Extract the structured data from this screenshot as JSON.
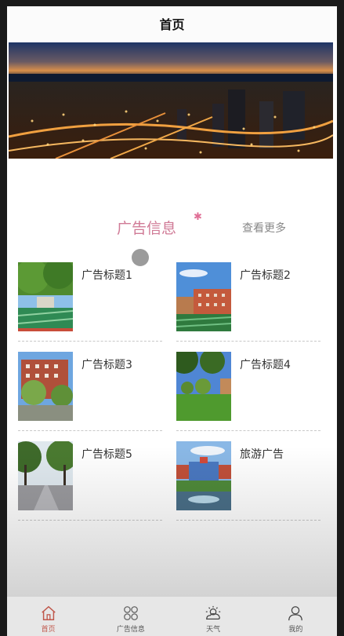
{
  "navbar": {
    "title": "首页"
  },
  "banner": {
    "alt": "city night skyline"
  },
  "section": {
    "title": "广告信息",
    "more": "查看更多"
  },
  "ads": [
    {
      "title": "广告标题1",
      "thumb": "campus-field-trees"
    },
    {
      "title": "广告标题2",
      "thumb": "campus-building-sky"
    },
    {
      "title": "广告标题3",
      "thumb": "red-building-trees"
    },
    {
      "title": "广告标题4",
      "thumb": "park-lawn-trees"
    },
    {
      "title": "广告标题5",
      "thumb": "tree-lined-road"
    },
    {
      "title": "旅游广告",
      "thumb": "campus-fountain"
    }
  ],
  "tabbar": {
    "items": [
      {
        "label": "首页",
        "icon": "home-icon",
        "active": true
      },
      {
        "label": "广告信息",
        "icon": "grid-icon",
        "active": false
      },
      {
        "label": "天气",
        "icon": "weather-icon",
        "active": false
      },
      {
        "label": "我的",
        "icon": "user-icon",
        "active": false
      }
    ]
  },
  "colors": {
    "accent": "#d07a96",
    "tab_active": "#c0574b"
  }
}
